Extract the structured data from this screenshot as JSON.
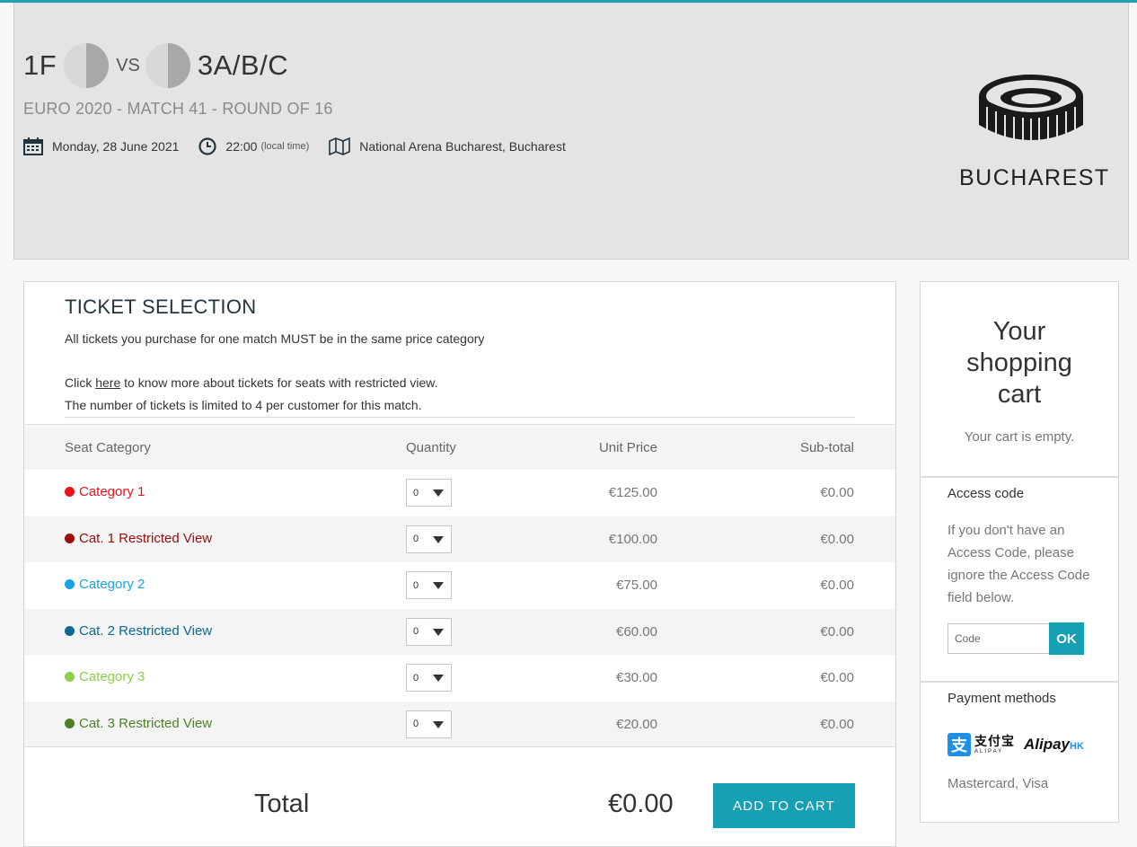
{
  "match": {
    "home": "1F",
    "vs": "VS",
    "away": "3A/B/C",
    "subtitle": "EURO 2020  - MATCH 41 - ROUND OF 16",
    "date": "Monday, 28 June 2021",
    "time": "22:00",
    "time_note": "(local time)",
    "venue": "National Arena Bucharest, Bucharest",
    "city": "BUCHAREST"
  },
  "ticket_selection": {
    "title": "TICKET SELECTION",
    "note": "All tickets you purchase for one match MUST be in the same price category",
    "click_prefix": "Click ",
    "click_link": "here",
    "click_suffix": " to know more about tickets for seats with restricted view.",
    "limit": "The number of tickets is limited to 4 per customer for this match.",
    "columns": [
      "Seat Category",
      "Quantity",
      "Unit Price",
      "Sub-total"
    ],
    "rows": [
      {
        "category": "Category 1",
        "color": "#e8141c",
        "qty": "0",
        "price": "€125.00",
        "subtotal": "€0.00"
      },
      {
        "category": "Cat. 1 Restricted View",
        "color": "#9b0c0c",
        "qty": "0",
        "price": "€100.00",
        "subtotal": "€0.00"
      },
      {
        "category": "Category 2",
        "color": "#1aa3e0",
        "qty": "0",
        "price": "€75.00",
        "subtotal": "€0.00"
      },
      {
        "category": "Cat. 2 Restricted View",
        "color": "#0b6a90",
        "qty": "0",
        "price": "€60.00",
        "subtotal": "€0.00"
      },
      {
        "category": "Category 3",
        "color": "#8ccf4a",
        "qty": "0",
        "price": "€30.00",
        "subtotal": "€0.00"
      },
      {
        "category": "Cat. 3 Restricted View",
        "color": "#4f7f27",
        "qty": "0",
        "price": "€20.00",
        "subtotal": "€0.00"
      }
    ],
    "total_label": "Total",
    "total_value": "€0.00",
    "add_to_cart": "ADD TO CART"
  },
  "cart": {
    "title_line1": "Your",
    "title_line2": "shopping",
    "title_line3": "cart",
    "empty": "Your cart is empty.",
    "access_heading": "Access code",
    "access_text": "If you don't have an Access Code, please ignore the Access Code field below.",
    "code_placeholder": "Code",
    "ok": "OK",
    "payment_heading": "Payment methods",
    "alipay_cn": "支付宝",
    "alipay_en": "ALIPAY",
    "alipay_hk_word": "Alipay",
    "alipay_hk_suffix": "HK",
    "payment_text": "Mastercard, Visa"
  },
  "colors": {
    "accent": "#179fb3"
  }
}
